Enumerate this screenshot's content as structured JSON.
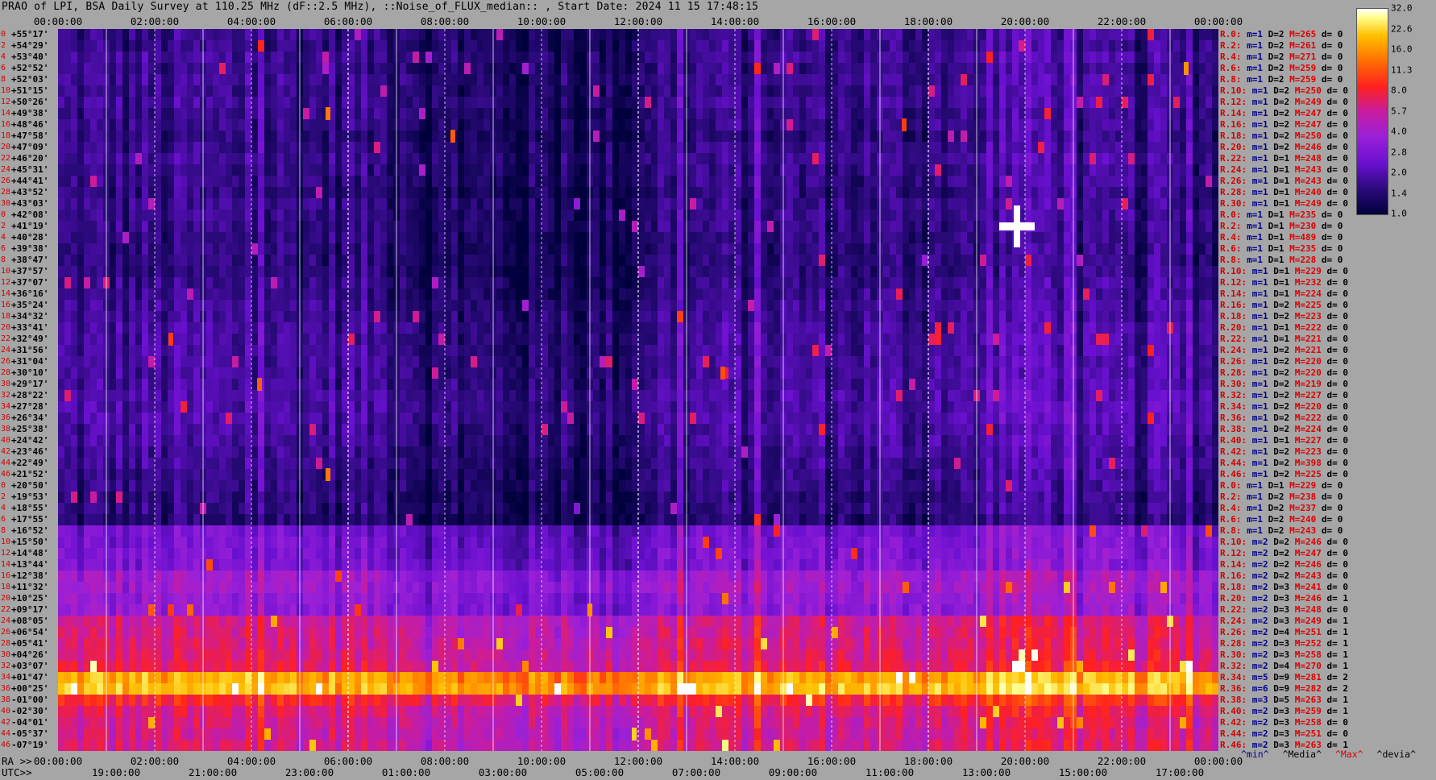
{
  "title": "PRAO of LPI, BSA Daily Survey at 110.25 MHz (dF::2.5 MHz), ::Noise_of_FLUX_median:: , Start Date: 2024 11 15 17:48:15",
  "chart_data": {
    "type": "heatmap",
    "title": "PRAO of LPI, BSA Daily Survey at 110.25 MHz (dF::2.5 MHz), ::Noise_of_FLUX_median:: , Start Date: 2024 11 15 17:48:15",
    "x_top_ticks": [
      "00:00:00",
      "02:00:00",
      "04:00:00",
      "06:00:00",
      "08:00:00",
      "10:00:00",
      "12:00:00",
      "14:00:00",
      "16:00:00",
      "18:00:00",
      "20:00:00",
      "22:00:00",
      "00:00:00"
    ],
    "ra_label": "RA >>",
    "ra_ticks": [
      "00:00:00",
      "02:00:00",
      "04:00:00",
      "06:00:00",
      "08:00:00",
      "10:00:00",
      "12:00:00",
      "14:00:00",
      "16:00:00",
      "18:00:00",
      "20:00:00",
      "22:00:00",
      "00:00:00"
    ],
    "utc_label": "UTC>>",
    "utc_ticks": [
      "19:00:00",
      "21:00:00",
      "23:00:00",
      "01:00:00",
      "03:00:00",
      "05:00:00",
      "07:00:00",
      "09:00:00",
      "11:00:00",
      "13:00:00",
      "15:00:00",
      "17:00:00"
    ],
    "colorbar": {
      "ticks": [
        "32.0",
        "22.6",
        "16.0",
        "11.3",
        "8.0",
        "5.7",
        "4.0",
        "2.8",
        "2.0",
        "1.4",
        "1.0"
      ],
      "range": [
        1.0,
        32.0
      ],
      "scale": "log"
    },
    "rows": [
      {
        "i": "0",
        "dec": "+55°17'",
        "r": "R.0:",
        "m": "m=1",
        "D": "D=2",
        "M": "M=265",
        "d": "d= 0"
      },
      {
        "i": "2",
        "dec": "+54°29'",
        "r": "R.2:",
        "m": "m=1",
        "D": "D=2",
        "M": "M=261",
        "d": "d= 0"
      },
      {
        "i": "4",
        "dec": "+53°40'",
        "r": "R.4:",
        "m": "m=1",
        "D": "D=2",
        "M": "M=271",
        "d": "d= 0"
      },
      {
        "i": "6",
        "dec": "+52°52'",
        "r": "R.6:",
        "m": "m=1",
        "D": "D=2",
        "M": "M=259",
        "d": "d= 0"
      },
      {
        "i": "8",
        "dec": "+52°03'",
        "r": "R.8:",
        "m": "m=1",
        "D": "D=2",
        "M": "M=259",
        "d": "d= 0"
      },
      {
        "i": "10",
        "dec": "+51°15'",
        "r": "R.10:",
        "m": "m=1",
        "D": "D=2",
        "M": "M=250",
        "d": "d= 0"
      },
      {
        "i": "12",
        "dec": "+50°26'",
        "r": "R.12:",
        "m": "m=1",
        "D": "D=2",
        "M": "M=249",
        "d": "d= 0"
      },
      {
        "i": "14",
        "dec": "+49°38'",
        "r": "R.14:",
        "m": "m=1",
        "D": "D=2",
        "M": "M=247",
        "d": "d= 0"
      },
      {
        "i": "16",
        "dec": "+48°46'",
        "r": "R.16:",
        "m": "m=1",
        "D": "D=2",
        "M": "M=247",
        "d": "d= 0"
      },
      {
        "i": "18",
        "dec": "+47°58'",
        "r": "R.18:",
        "m": "m=1",
        "D": "D=2",
        "M": "M=250",
        "d": "d= 0"
      },
      {
        "i": "20",
        "dec": "+47°09'",
        "r": "R.20:",
        "m": "m=1",
        "D": "D=2",
        "M": "M=246",
        "d": "d= 0"
      },
      {
        "i": "22",
        "dec": "+46°20'",
        "r": "R.22:",
        "m": "m=1",
        "D": "D=1",
        "M": "M=248",
        "d": "d= 0"
      },
      {
        "i": "24",
        "dec": "+45°31'",
        "r": "R.24:",
        "m": "m=1",
        "D": "D=1",
        "M": "M=243",
        "d": "d= 0"
      },
      {
        "i": "26",
        "dec": "+44°41'",
        "r": "R.26:",
        "m": "m=1",
        "D": "D=1",
        "M": "M=243",
        "d": "d= 0"
      },
      {
        "i": "28",
        "dec": "+43°52'",
        "r": "R.28:",
        "m": "m=1",
        "D": "D=1",
        "M": "M=240",
        "d": "d= 0"
      },
      {
        "i": "30",
        "dec": "+43°03'",
        "r": "R.30:",
        "m": "m=1",
        "D": "D=1",
        "M": "M=249",
        "d": "d= 0"
      },
      {
        "i": "0",
        "dec": "+42°08'",
        "r": "R.0:",
        "m": "m=1",
        "D": "D=1",
        "M": "M=235",
        "d": "d= 0"
      },
      {
        "i": "2",
        "dec": "+41°19'",
        "r": "R.2:",
        "m": "m=1",
        "D": "D=1",
        "M": "M=230",
        "d": "d= 0"
      },
      {
        "i": "4",
        "dec": "+40°28'",
        "r": "R.4:",
        "m": "m=1",
        "D": "D=1",
        "M": "M=489",
        "d": "d= 0"
      },
      {
        "i": "6",
        "dec": "+39°38'",
        "r": "R.6:",
        "m": "m=1",
        "D": "D=1",
        "M": "M=235",
        "d": "d= 0"
      },
      {
        "i": "8",
        "dec": "+38°47'",
        "r": "R.8:",
        "m": "m=1",
        "D": "D=1",
        "M": "M=228",
        "d": "d= 0"
      },
      {
        "i": "10",
        "dec": "+37°57'",
        "r": "R.10:",
        "m": "m=1",
        "D": "D=1",
        "M": "M=229",
        "d": "d= 0"
      },
      {
        "i": "12",
        "dec": "+37°07'",
        "r": "R.12:",
        "m": "m=1",
        "D": "D=1",
        "M": "M=232",
        "d": "d= 0"
      },
      {
        "i": "14",
        "dec": "+36°16'",
        "r": "R.14:",
        "m": "m=1",
        "D": "D=1",
        "M": "M=224",
        "d": "d= 0"
      },
      {
        "i": "16",
        "dec": "+35°24'",
        "r": "R.16:",
        "m": "m=1",
        "D": "D=2",
        "M": "M=225",
        "d": "d= 0"
      },
      {
        "i": "18",
        "dec": "+34°32'",
        "r": "R.18:",
        "m": "m=1",
        "D": "D=2",
        "M": "M=223",
        "d": "d= 0"
      },
      {
        "i": "20",
        "dec": "+33°41'",
        "r": "R.20:",
        "m": "m=1",
        "D": "D=1",
        "M": "M=222",
        "d": "d= 0"
      },
      {
        "i": "22",
        "dec": "+32°49'",
        "r": "R.22:",
        "m": "m=1",
        "D": "D=1",
        "M": "M=221",
        "d": "d= 0"
      },
      {
        "i": "24",
        "dec": "+31°56'",
        "r": "R.24:",
        "m": "m=1",
        "D": "D=2",
        "M": "M=221",
        "d": "d= 0"
      },
      {
        "i": "26",
        "dec": "+31°04'",
        "r": "R.26:",
        "m": "m=1",
        "D": "D=2",
        "M": "M=220",
        "d": "d= 0"
      },
      {
        "i": "28",
        "dec": "+30°10'",
        "r": "R.28:",
        "m": "m=1",
        "D": "D=2",
        "M": "M=220",
        "d": "d= 0"
      },
      {
        "i": "30",
        "dec": "+29°17'",
        "r": "R.30:",
        "m": "m=1",
        "D": "D=2",
        "M": "M=219",
        "d": "d= 0"
      },
      {
        "i": "32",
        "dec": "+28°22'",
        "r": "R.32:",
        "m": "m=1",
        "D": "D=2",
        "M": "M=227",
        "d": "d= 0"
      },
      {
        "i": "34",
        "dec": "+27°28'",
        "r": "R.34:",
        "m": "m=1",
        "D": "D=2",
        "M": "M=220",
        "d": "d= 0"
      },
      {
        "i": "36",
        "dec": "+26°34'",
        "r": "R.36:",
        "m": "m=1",
        "D": "D=2",
        "M": "M=222",
        "d": "d= 0"
      },
      {
        "i": "38",
        "dec": "+25°38'",
        "r": "R.38:",
        "m": "m=1",
        "D": "D=2",
        "M": "M=224",
        "d": "d= 0"
      },
      {
        "i": "40",
        "dec": "+24°42'",
        "r": "R.40:",
        "m": "m=1",
        "D": "D=1",
        "M": "M=227",
        "d": "d= 0"
      },
      {
        "i": "42",
        "dec": "+23°46'",
        "r": "R.42:",
        "m": "m=1",
        "D": "D=2",
        "M": "M=223",
        "d": "d= 0"
      },
      {
        "i": "44",
        "dec": "+22°49'",
        "r": "R.44:",
        "m": "m=1",
        "D": "D=2",
        "M": "M=398",
        "d": "d= 0"
      },
      {
        "i": "46",
        "dec": "+21°52'",
        "r": "R.46:",
        "m": "m=1",
        "D": "D=2",
        "M": "M=225",
        "d": "d= 0"
      },
      {
        "i": "0",
        "dec": "+20°50'",
        "r": "R.0:",
        "m": "m=1",
        "D": "D=1",
        "M": "M=229",
        "d": "d= 0"
      },
      {
        "i": "2",
        "dec": "+19°53'",
        "r": "R.2:",
        "m": "m=1",
        "D": "D=2",
        "M": "M=238",
        "d": "d= 0"
      },
      {
        "i": "4",
        "dec": "+18°55'",
        "r": "R.4:",
        "m": "m=1",
        "D": "D=2",
        "M": "M=237",
        "d": "d= 0"
      },
      {
        "i": "6",
        "dec": "+17°55'",
        "r": "R.6:",
        "m": "m=1",
        "D": "D=2",
        "M": "M=240",
        "d": "d= 0"
      },
      {
        "i": "8",
        "dec": "+16°52'",
        "r": "R.8:",
        "m": "m=1",
        "D": "D=2",
        "M": "M=243",
        "d": "d= 0"
      },
      {
        "i": "10",
        "dec": "+15°50'",
        "r": "R.10:",
        "m": "m=2",
        "D": "D=2",
        "M": "M=246",
        "d": "d= 0"
      },
      {
        "i": "12",
        "dec": "+14°48'",
        "r": "R.12:",
        "m": "m=2",
        "D": "D=2",
        "M": "M=247",
        "d": "d= 0"
      },
      {
        "i": "14",
        "dec": "+13°44'",
        "r": "R.14:",
        "m": "m=2",
        "D": "D=2",
        "M": "M=246",
        "d": "d= 0"
      },
      {
        "i": "16",
        "dec": "+12°38'",
        "r": "R.16:",
        "m": "m=2",
        "D": "D=2",
        "M": "M=243",
        "d": "d= 0"
      },
      {
        "i": "18",
        "dec": "+11°32'",
        "r": "R.18:",
        "m": "m=2",
        "D": "D=3",
        "M": "M=241",
        "d": "d= 0"
      },
      {
        "i": "20",
        "dec": "+10°25'",
        "r": "R.20:",
        "m": "m=2",
        "D": "D=3",
        "M": "M=246",
        "d": "d= 1"
      },
      {
        "i": "22",
        "dec": "+09°17'",
        "r": "R.22:",
        "m": "m=2",
        "D": "D=3",
        "M": "M=248",
        "d": "d= 0"
      },
      {
        "i": "24",
        "dec": "+08°05'",
        "r": "R.24:",
        "m": "m=2",
        "D": "D=3",
        "M": "M=249",
        "d": "d= 1"
      },
      {
        "i": "26",
        "dec": "+06°54'",
        "r": "R.26:",
        "m": "m=2",
        "D": "D=4",
        "M": "M=251",
        "d": "d= 1"
      },
      {
        "i": "28",
        "dec": "+05°41'",
        "r": "R.28:",
        "m": "m=2",
        "D": "D=3",
        "M": "M=252",
        "d": "d= 1"
      },
      {
        "i": "30",
        "dec": "+04°26'",
        "r": "R.30:",
        "m": "m=2",
        "D": "D=3",
        "M": "M=258",
        "d": "d= 1"
      },
      {
        "i": "32",
        "dec": "+03°07'",
        "r": "R.32:",
        "m": "m=2",
        "D": "D=4",
        "M": "M=270",
        "d": "d= 1"
      },
      {
        "i": "34",
        "dec": "+01°47'",
        "r": "R.34:",
        "m": "m=5",
        "D": "D=9",
        "M": "M=281",
        "d": "d= 2"
      },
      {
        "i": "36",
        "dec": "+00°25'",
        "r": "R.36:",
        "m": "m=6",
        "D": "D=9",
        "M": "M=282",
        "d": "d= 2"
      },
      {
        "i": "38",
        "dec": "-01°00'",
        "r": "R.38:",
        "m": "m=3",
        "D": "D=5",
        "M": "M=263",
        "d": "d= 1"
      },
      {
        "i": "40",
        "dec": "-02°30'",
        "r": "R.40:",
        "m": "m=2",
        "D": "D=3",
        "M": "M=259",
        "d": "d= 1"
      },
      {
        "i": "42",
        "dec": "-04°01'",
        "r": "R.42:",
        "m": "m=2",
        "D": "D=3",
        "M": "M=258",
        "d": "d= 0"
      },
      {
        "i": "44",
        "dec": "-05°37'",
        "r": "R.44:",
        "m": "m=2",
        "D": "D=3",
        "M": "M=251",
        "d": "d= 0"
      },
      {
        "i": "46",
        "dec": "-07°19'",
        "r": "R.46:",
        "m": "m=2",
        "D": "D=3",
        "M": "M=263",
        "d": "d= 1"
      }
    ],
    "legend_bottom": {
      "min": "^min^",
      "median": "^Media^",
      "max": "^Max^",
      "devia": "^devia^"
    },
    "bands": {
      "row_levels": [
        1.6,
        1.6,
        1.7,
        1.6,
        1.7,
        1.6,
        1.7,
        1.6,
        1.6,
        1.5,
        1.6,
        1.7,
        1.6,
        1.6,
        1.5,
        1.6,
        1.6,
        1.6,
        1.5,
        1.5,
        1.5,
        1.5,
        1.6,
        1.6,
        1.7,
        1.7,
        1.8,
        1.8,
        1.8,
        1.8,
        1.8,
        1.8,
        1.9,
        1.9,
        1.9,
        1.8,
        1.8,
        1.7,
        1.7,
        1.6,
        1.6,
        1.5,
        1.5,
        1.4,
        2.6,
        2.7,
        2.8,
        2.8,
        3.8,
        3.9,
        3.5,
        3.4,
        5.8,
        6.0,
        6.2,
        6.5,
        7.0,
        18.0,
        20.0,
        8.5,
        6.5,
        6.0,
        5.8,
        6.0
      ]
    },
    "features": [
      {
        "type": "point",
        "ra": "19:50:00",
        "row": 17,
        "level": 32
      },
      {
        "type": "point",
        "ra": "05:35:00",
        "row": 39,
        "level": 14
      },
      {
        "type": "point",
        "ra": "11:00:00",
        "row": 51,
        "level": 16
      },
      {
        "type": "point",
        "ra": "11:55:00",
        "row": 62,
        "level": 22
      },
      {
        "type": "point",
        "ra": "23:20:00",
        "row": 3,
        "level": 16
      },
      {
        "type": "point",
        "ra": "05:35:00",
        "row": 7,
        "level": 14
      },
      {
        "type": "point",
        "ra": "08:10:00",
        "row": 9,
        "level": 12
      },
      {
        "type": "point",
        "ra": "17:30:00",
        "row": 8,
        "level": 10
      },
      {
        "type": "point",
        "ra": "13:45:00",
        "row": 30,
        "level": 11
      },
      {
        "type": "point",
        "ra": "04:10:00",
        "row": 31,
        "level": 12
      },
      {
        "type": "point",
        "ra": "02:20:00",
        "row": 27,
        "level": 10
      }
    ]
  }
}
